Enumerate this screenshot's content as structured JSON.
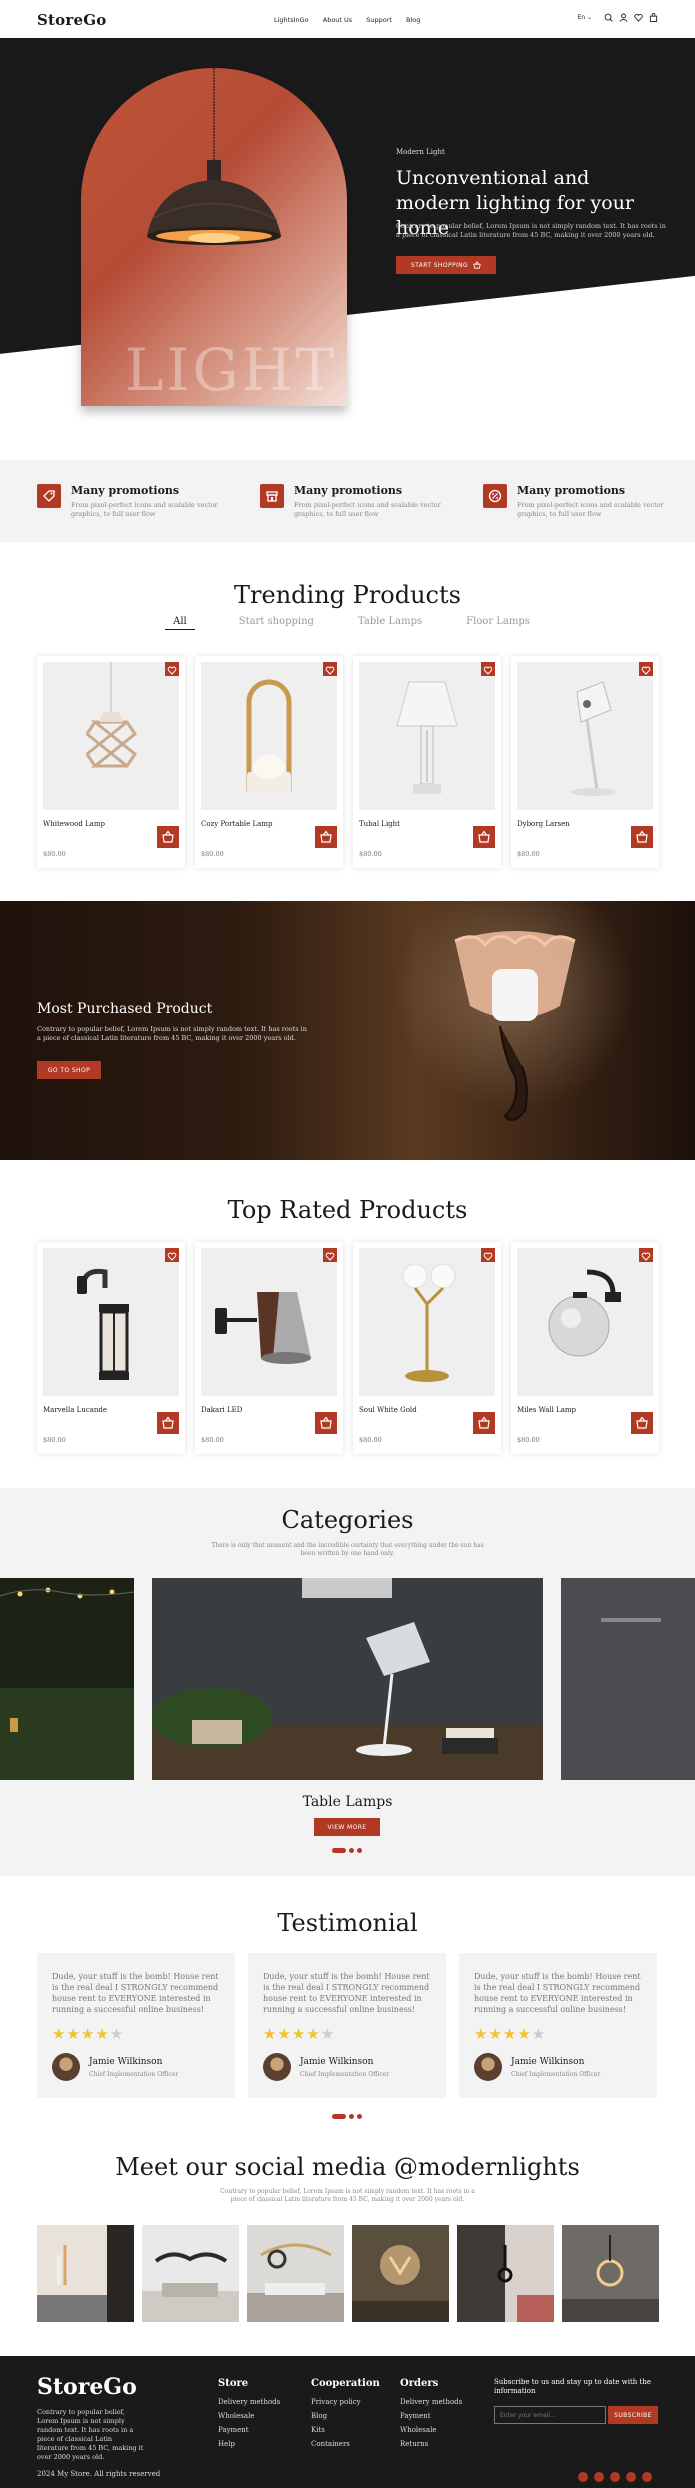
{
  "header": {
    "logo": "StoreGo",
    "nav": [
      "LightsInGo",
      "About Us",
      "Support",
      "Blog"
    ],
    "lang": "En ⌄"
  },
  "hero": {
    "subtitle": "Modern Light",
    "title": "Unconventional and modern lighting for your home",
    "text": "Contrary to popular belief, Lorem Ipsum is not simply random text. It has roots in a piece of classical Latin literature from 45 BC, making it over 2000 years old.",
    "button": "START SHOPPING",
    "word": "LIGHT"
  },
  "features": [
    {
      "title": "Many promotions",
      "text": "From pixel-perfect icons and scalable vector graphics, to full user flow",
      "icon": "tag-icon"
    },
    {
      "title": "Many promotions",
      "text": "From pixel-perfect icons and scalable vector graphics, to full user flow",
      "icon": "store-icon"
    },
    {
      "title": "Many promotions",
      "text": "From pixel-perfect icons and scalable vector graphics, to full user flow",
      "icon": "discount-icon"
    }
  ],
  "trending": {
    "title": "Trending Products",
    "tabs": [
      "All",
      "Start shopping",
      "Table Lamps",
      "Floor Lamps"
    ],
    "products": [
      {
        "name": "Whitewood Lamp",
        "price": "$80.00"
      },
      {
        "name": "Cozy Portable Lamp",
        "price": "$80.00"
      },
      {
        "name": "Tubal Light",
        "price": "$80.00"
      },
      {
        "name": "Dyborg Larsen",
        "price": "$80.00"
      }
    ]
  },
  "promo": {
    "title": "Most Purchased Product",
    "text": "Contrary to popular belief, Lorem Ipsum is not simply random text. It has roots in a piece of classical Latin literature from 45 BC, making it over 2000 years old.",
    "button": "GO TO SHOP"
  },
  "top_rated": {
    "title": "Top Rated Products",
    "products": [
      {
        "name": "Marvella Lucande",
        "price": "$80.00"
      },
      {
        "name": "Dakari LED",
        "price": "$80.00"
      },
      {
        "name": "Soul White Gold",
        "price": "$80.00"
      },
      {
        "name": "Miles Wall Lamp",
        "price": "$80.00"
      }
    ]
  },
  "categories": {
    "title": "Categories",
    "text": "There is only that moment and the incredible certainty that everything under the sun has been written by one hand only.",
    "current": "Table Lamps",
    "button": "VIEW MORE"
  },
  "testimonial": {
    "title": "Testimonial",
    "items": [
      {
        "text": "Dude, your stuff is the bomb! House rent is the real deal I STRONGLY recommend house rent to EVERYONE interested in running a successful online business!",
        "stars": "★★★★★",
        "name": "Jamie Wilkinson",
        "role": "Chief Implementation Officer"
      },
      {
        "text": "Dude, your stuff is the bomb! House rent is the real deal I STRONGLY recommend house rent to EVERYONE interested in running a successful online business!",
        "stars": "★★★★★",
        "name": "Jamie Wilkinson",
        "role": "Chief Implementation Officer"
      },
      {
        "text": "Dude, your stuff is the bomb! House rent is the real deal I STRONGLY recommend house rent to EVERYONE interested in running a successful online business!",
        "stars": "★★★★★",
        "name": "Jamie Wilkinson",
        "role": "Chief Implementation Officer"
      }
    ],
    "rating": 4
  },
  "social": {
    "title": "Meet our social media @modernlights",
    "text": "Contrary to popular belief, Lorem Ipsum is not simply random text. It has roots in a piece of classical Latin literature from 45 BC, making it over 2000 years old."
  },
  "footer": {
    "logo": "StoreGo",
    "about": "Contrary to popular belief, Lorem Ipsum is not simply random text. It has roots in a piece of classical Latin literature from 45 BC, making it over 2000 years old.",
    "columns": [
      {
        "title": "Store",
        "links": [
          "Delivery methods",
          "Wholesale",
          "Payment",
          "Help"
        ]
      },
      {
        "title": "Cooperation",
        "links": [
          "Privacy policy",
          "Blog",
          "Kits",
          "Containers"
        ]
      },
      {
        "title": "Orders",
        "links": [
          "Delivery methods",
          "Payment",
          "Wholesale",
          "Returns"
        ]
      }
    ],
    "subscribe_text": "Subscribe to us and stay up to date with the information",
    "email_placeholder": "Enter your email...",
    "subscribe_button": "SUBSCRIBE",
    "copyright": "2024 My Store. All rights reserved"
  },
  "colors": {
    "accent": "#b23a25",
    "dark": "#1a1a1a",
    "light_bg": "#f3f3f3"
  }
}
